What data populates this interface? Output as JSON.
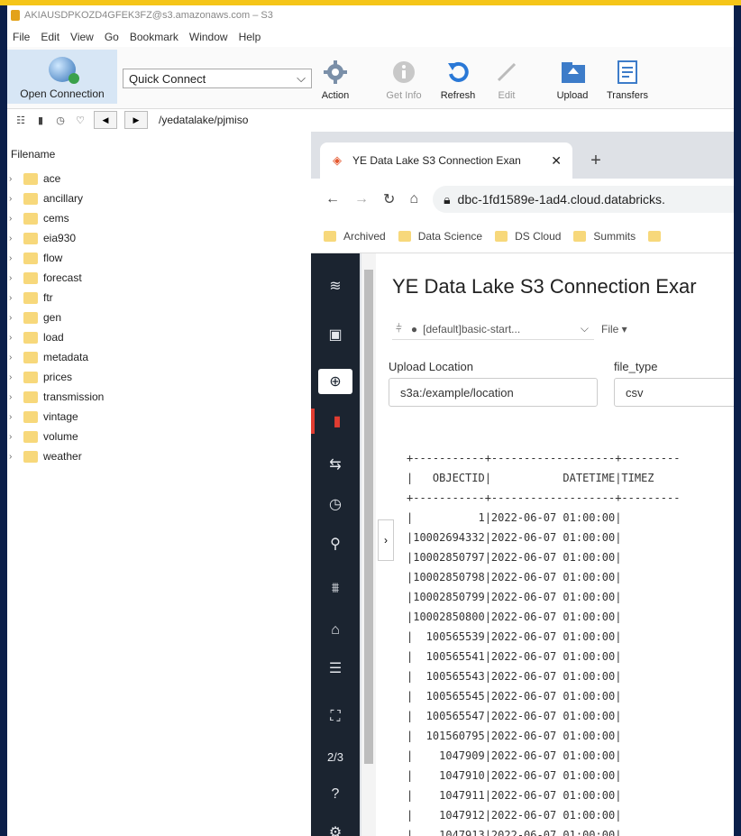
{
  "window": {
    "title": "AKIAUSDPKOZD4GFEK3FZ@s3.amazonaws.com – S3"
  },
  "menu": [
    "File",
    "Edit",
    "View",
    "Go",
    "Bookmark",
    "Window",
    "Help"
  ],
  "toolbar": {
    "open_connection": "Open Connection",
    "quick_connect": "Quick Connect",
    "action": "Action",
    "get_info": "Get Info",
    "refresh": "Refresh",
    "edit": "Edit",
    "upload": "Upload",
    "transfers": "Transfers"
  },
  "path": "/yedatalake/pjmiso",
  "files": {
    "header": "Filename",
    "items": [
      "ace",
      "ancillary",
      "cems",
      "eia930",
      "flow",
      "forecast",
      "ftr",
      "gen",
      "load",
      "metadata",
      "prices",
      "transmission",
      "vintage",
      "volume",
      "weather"
    ]
  },
  "browser": {
    "tab_title": "YE Data Lake S3 Connection Exan",
    "url": "dbc-1fd1589e-1ad4.cloud.databricks.",
    "bookmarks": [
      "Archived",
      "Data Science",
      "DS Cloud",
      "Summits"
    ]
  },
  "notebook": {
    "title": "YE Data Lake S3 Connection Exar",
    "cluster": "[default]basic-start...",
    "file_menu": "File ▾",
    "upload_label": "Upload Location",
    "upload_value": "s3a:/example/location",
    "filetype_label": "file_type",
    "filetype_value": "csv",
    "sidebar_page": "2/3",
    "output": {
      "separator": "+-----------+-------------------+---------",
      "header": "|   OBJECTID|           DATETIME|TIMEZ",
      "rows": [
        "|          1|2022-06-07 01:00:00|",
        "|10002694332|2022-06-07 01:00:00|",
        "|10002850797|2022-06-07 01:00:00|",
        "|10002850798|2022-06-07 01:00:00|",
        "|10002850799|2022-06-07 01:00:00|",
        "|10002850800|2022-06-07 01:00:00|",
        "|  100565539|2022-06-07 01:00:00|",
        "|  100565541|2022-06-07 01:00:00|",
        "|  100565543|2022-06-07 01:00:00|",
        "|  100565545|2022-06-07 01:00:00|",
        "|  100565547|2022-06-07 01:00:00|",
        "|  101560795|2022-06-07 01:00:00|",
        "|    1047909|2022-06-07 01:00:00|",
        "|    1047910|2022-06-07 01:00:00|",
        "|    1047911|2022-06-07 01:00:00|",
        "|    1047912|2022-06-07 01:00:00|",
        "|    1047913|2022-06-07 01:00:00|"
      ]
    }
  },
  "colors": {
    "accent_yellow": "#f5c518",
    "folder": "#f7d87b",
    "databricks_sidebar": "#1b2430",
    "databricks_red": "#e03c31"
  }
}
